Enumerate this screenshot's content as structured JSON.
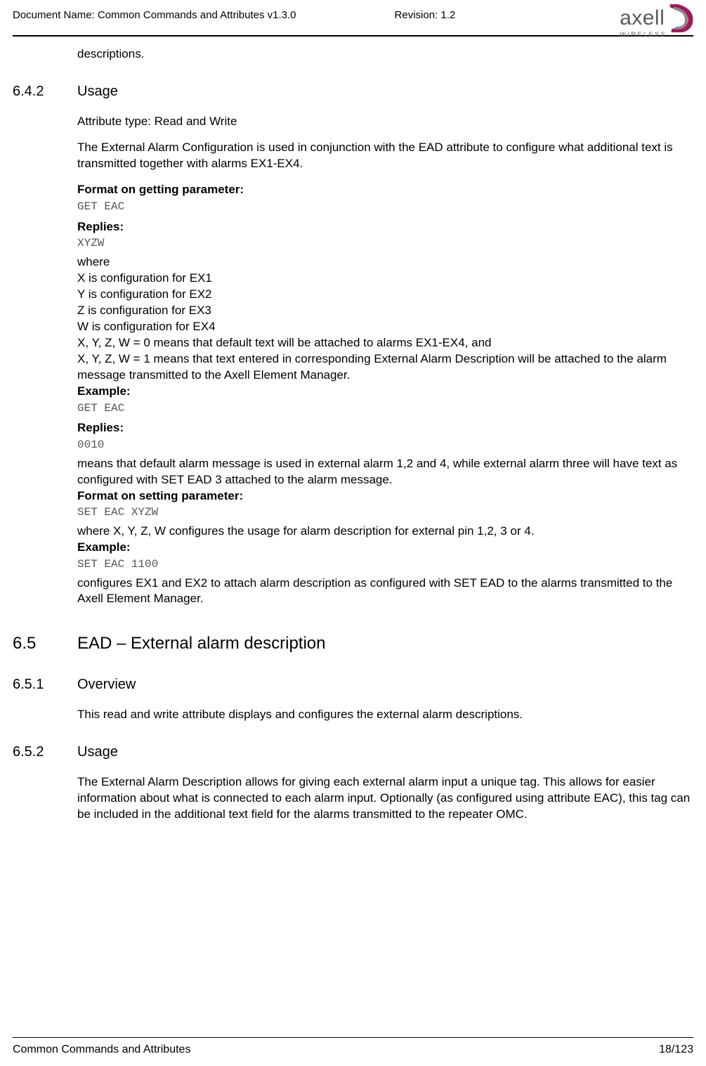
{
  "header": {
    "doc_name_label": "Document Name: Common Commands and Attributes v1.3.0",
    "revision_label": "Revision: 1.2",
    "logo_main": "axell",
    "logo_sub": "WIRELESS"
  },
  "continuation_text": "descriptions.",
  "s642": {
    "num": "6.4.2",
    "title": "Usage",
    "attr_type": "Attribute type: Read and Write",
    "intro": "The External Alarm Configuration is used in conjunction with the EAD attribute to configure what additional text is transmitted together with alarms EX1-EX4.",
    "format_get_label": "Format on getting parameter:",
    "format_get_cmd": "GET EAC",
    "replies_label_1": "Replies:",
    "replies_val_1": "XYZW",
    "where_l0": "where",
    "where_l1": "X is configuration for EX1",
    "where_l2": "Y is configuration for EX2",
    "where_l3": "Z is configuration for EX3",
    "where_l4": "W is configuration for EX4",
    "where_l5": "X, Y, Z, W = 0 means that default text will be attached to alarms EX1-EX4, and",
    "where_l6": "X, Y, Z, W = 1 means that text entered in corresponding External Alarm Description will be attached to the alarm message transmitted to the Axell Element Manager.",
    "example_label_1": "Example:",
    "example_cmd_1": "GET EAC",
    "replies_label_2": "Replies:",
    "replies_val_2": "0010",
    "means_text": "means that default alarm message is used in external alarm 1,2 and 4, while external alarm three will have text as configured with SET EAD 3 attached to the alarm message.",
    "format_set_label": "Format on setting parameter:",
    "format_set_cmd": "SET EAC XYZW",
    "where_set": "where X, Y, Z, W configures the usage for alarm description for external pin 1,2, 3 or 4.",
    "example_label_2": "Example:",
    "example_cmd_2": "SET EAC 1100",
    "configures_text": "configures EX1 and EX2 to attach alarm description as configured with SET EAD to the alarms transmitted to the Axell Element Manager."
  },
  "s65": {
    "num": "6.5",
    "title": "EAD – External alarm description"
  },
  "s651": {
    "num": "6.5.1",
    "title": "Overview",
    "text": "This read and write attribute displays and configures the external alarm descriptions."
  },
  "s652": {
    "num": "6.5.2",
    "title": "Usage",
    "text": "The External Alarm Description allows for giving each external alarm input a unique tag. This allows for easier information about what is connected to each alarm input. Optionally (as configured using attribute EAC), this tag can be included in the additional text field for the alarms transmitted to the repeater OMC."
  },
  "footer": {
    "left": "Common Commands and Attributes",
    "right": "18/123"
  }
}
